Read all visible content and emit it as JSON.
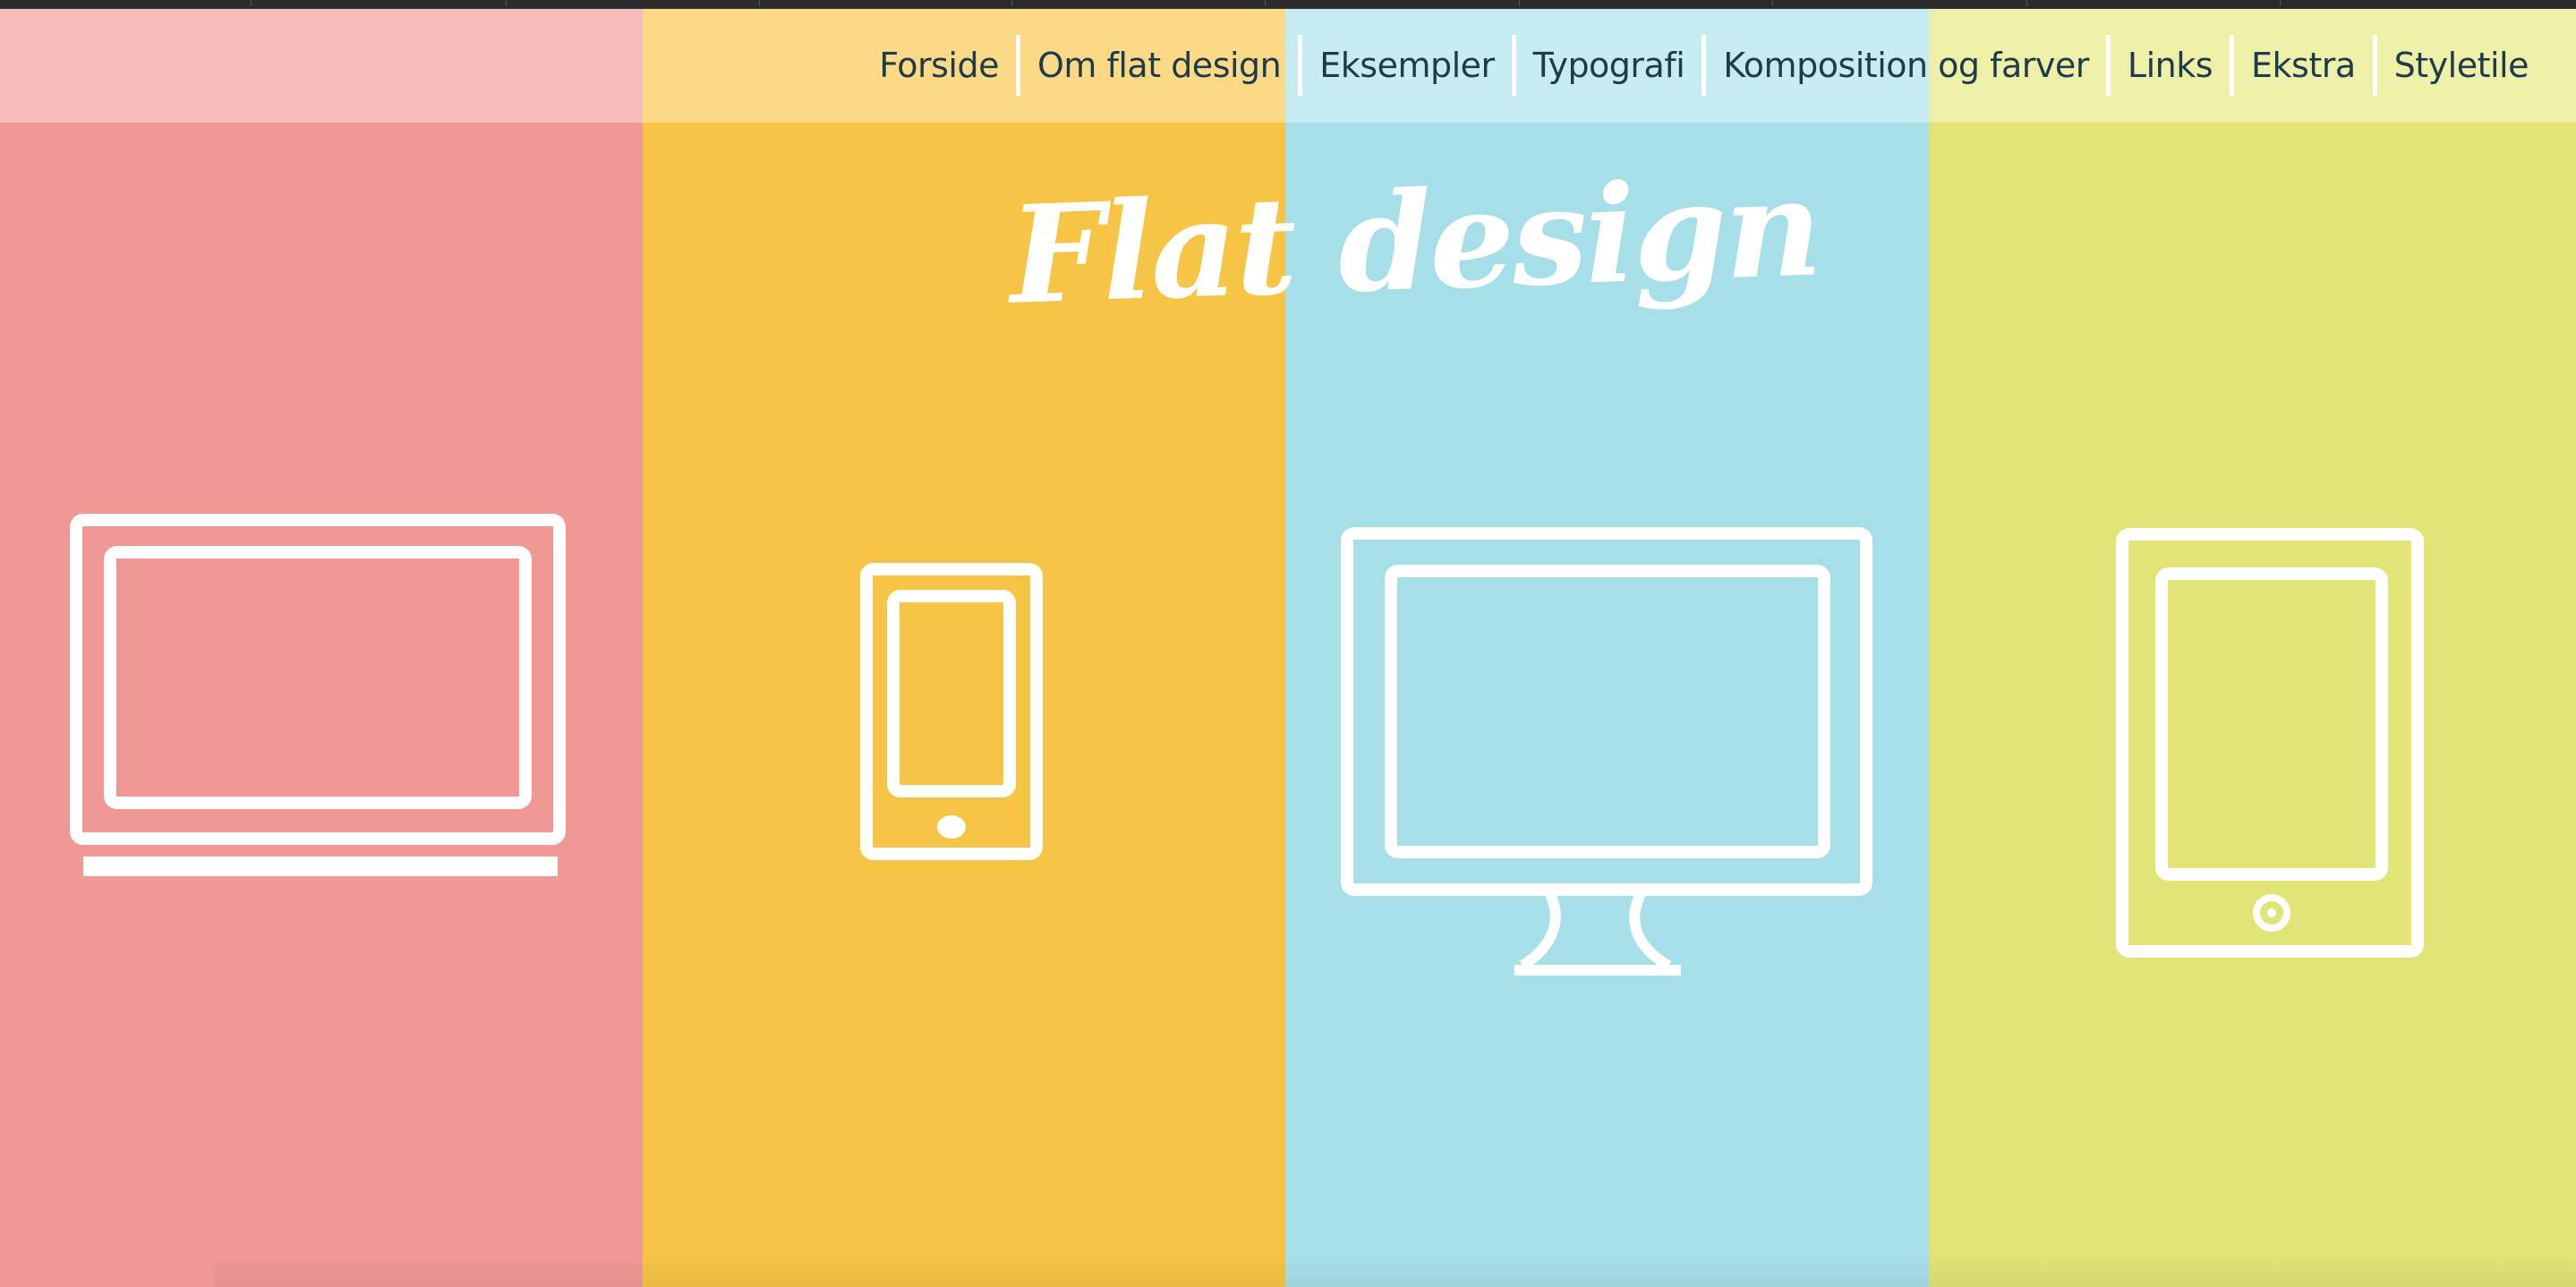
{
  "title": "Flat design",
  "nav": {
    "items": [
      {
        "label": "Forside"
      },
      {
        "label": "Om flat design"
      },
      {
        "label": "Eksempler"
      },
      {
        "label": "Typografi"
      },
      {
        "label": "Komposition og farver"
      },
      {
        "label": "Links"
      },
      {
        "label": "Ekstra"
      },
      {
        "label": "Styletile"
      }
    ]
  },
  "columns": [
    {
      "icon": "laptop-icon",
      "color": "#f09896"
    },
    {
      "icon": "smartphone-icon",
      "color": "#f6c545"
    },
    {
      "icon": "desktop-monitor-icon",
      "color": "#a7dfe8"
    },
    {
      "icon": "tablet-icon",
      "color": "#e1e476"
    }
  ],
  "navbar_tints": [
    "#f7bcbc",
    "#fcd987",
    "#c6ebf1",
    "#eef0a9"
  ],
  "colors": {
    "nav_text": "#1f3a4a",
    "icon_stroke": "#ffffff"
  }
}
